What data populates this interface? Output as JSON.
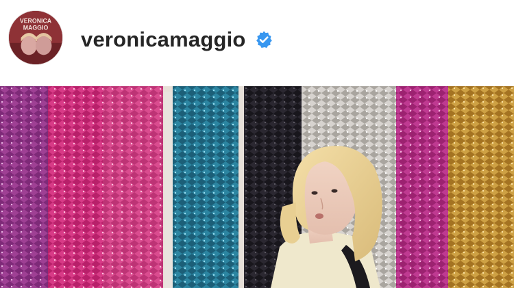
{
  "profile": {
    "username": "veronicamaggio",
    "verified": true,
    "avatar_icon": "avatar-image",
    "avatar_text": "VERONICA MAGGIO"
  },
  "verified_icon": "verified-badge-icon",
  "colors": {
    "verified_blue": "#3897f0",
    "username_text": "#262626",
    "tinsel_purple": "#8a2f7e",
    "tinsel_magenta": "#c3286f",
    "tinsel_teal": "#1f6d86",
    "tinsel_black": "#1d1b22",
    "tinsel_silver": "#c9c6c2",
    "tinsel_fuchsia": "#b0287a",
    "tinsel_gold": "#b8882e"
  },
  "post": {
    "image_subject": "photo-woman-in-front-of-tinsel-curtain"
  }
}
